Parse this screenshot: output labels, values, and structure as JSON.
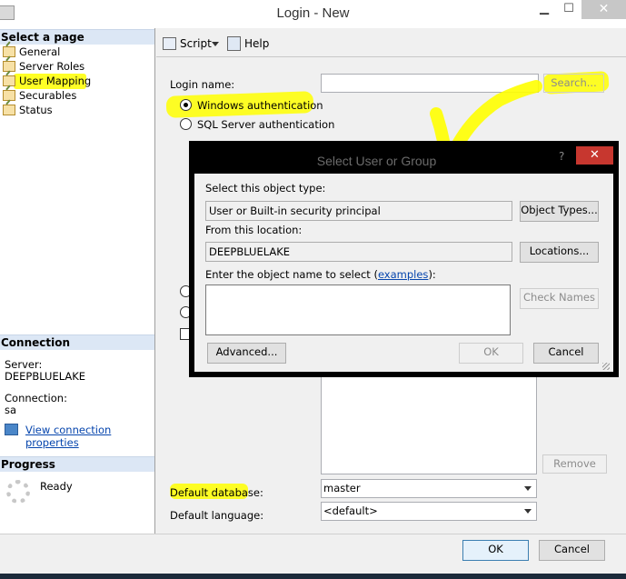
{
  "window": {
    "title": "Login - New"
  },
  "sidebar": {
    "select_page_header": "Select a page",
    "pages": [
      "General",
      "Server Roles",
      "User Mapping",
      "Securables",
      "Status"
    ],
    "connection_header": "Connection",
    "server_label": "Server:",
    "server_value": "DEEPBLUELAKE",
    "connection_label": "Connection:",
    "connection_value": "sa",
    "view_connection_link": "View connection properties",
    "progress_header": "Progress",
    "progress_status": "Ready"
  },
  "toolbar": {
    "script_label": "Script",
    "help_label": "Help"
  },
  "main": {
    "login_name_label": "Login name:",
    "login_name_value": "",
    "search_button": "Search...",
    "windows_auth_label": "Windows authentication",
    "sql_auth_label": "SQL Server authentication",
    "remove_button": "Remove",
    "default_database_label": "Default database:",
    "default_database_value": "master",
    "default_language_label": "Default language:",
    "default_language_value": "<default>"
  },
  "footer": {
    "ok_button": "OK",
    "cancel_button": "Cancel"
  },
  "dialog": {
    "title": "Select User or Group",
    "help_glyph": "?",
    "close_glyph": "✕",
    "object_type_label": "Select this object type:",
    "object_type_value": "User or Built-in security principal",
    "object_types_button": "Object Types...",
    "location_label": "From this location:",
    "location_value": "DEEPBLUELAKE",
    "locations_button": "Locations...",
    "enter_name_label_pre": "Enter the object name to select (",
    "examples_link": "examples",
    "enter_name_label_post": "):",
    "object_name_value": "",
    "check_names_button": "Check Names",
    "advanced_button": "Advanced...",
    "ok_button": "OK",
    "cancel_button": "Cancel"
  },
  "colors": {
    "highlight": "#ffff00",
    "sidebar_header_bg": "#dce7f5",
    "dialog_border": "#000000",
    "close_red": "#c7372f",
    "link": "#0645ad"
  }
}
